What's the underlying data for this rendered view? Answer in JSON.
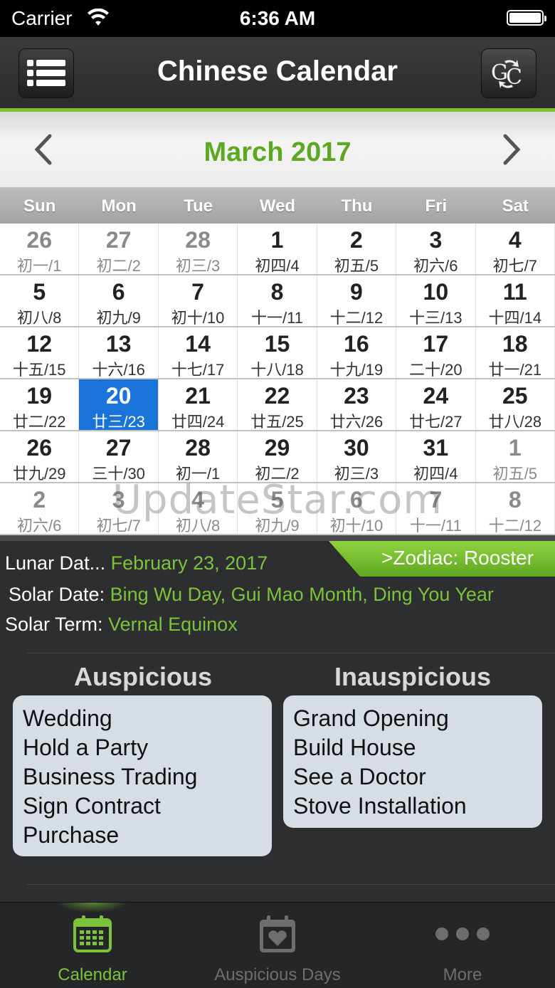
{
  "status": {
    "carrier": "Carrier",
    "time": "6:36 AM"
  },
  "nav": {
    "title": "Chinese Calendar"
  },
  "month": {
    "title": "March 2017"
  },
  "weekdays": [
    "Sun",
    "Mon",
    "Tue",
    "Wed",
    "Thu",
    "Fri",
    "Sat"
  ],
  "weeks": [
    [
      {
        "d": "26",
        "l": "初一/1",
        "o": true
      },
      {
        "d": "27",
        "l": "初二/2",
        "o": true
      },
      {
        "d": "28",
        "l": "初三/3",
        "o": true
      },
      {
        "d": "1",
        "l": "初四/4"
      },
      {
        "d": "2",
        "l": "初五/5"
      },
      {
        "d": "3",
        "l": "初六/6"
      },
      {
        "d": "4",
        "l": "初七/7"
      }
    ],
    [
      {
        "d": "5",
        "l": "初八/8"
      },
      {
        "d": "6",
        "l": "初九/9"
      },
      {
        "d": "7",
        "l": "初十/10"
      },
      {
        "d": "8",
        "l": "十一/11"
      },
      {
        "d": "9",
        "l": "十二/12"
      },
      {
        "d": "10",
        "l": "十三/13"
      },
      {
        "d": "11",
        "l": "十四/14"
      }
    ],
    [
      {
        "d": "12",
        "l": "十五/15"
      },
      {
        "d": "13",
        "l": "十六/16"
      },
      {
        "d": "14",
        "l": "十七/17"
      },
      {
        "d": "15",
        "l": "十八/18"
      },
      {
        "d": "16",
        "l": "十九/19"
      },
      {
        "d": "17",
        "l": "二十/20"
      },
      {
        "d": "18",
        "l": "廿一/21"
      }
    ],
    [
      {
        "d": "19",
        "l": "廿二/22"
      },
      {
        "d": "20",
        "l": "廿三/23",
        "t": true
      },
      {
        "d": "21",
        "l": "廿四/24"
      },
      {
        "d": "22",
        "l": "廿五/25"
      },
      {
        "d": "23",
        "l": "廿六/26"
      },
      {
        "d": "24",
        "l": "廿七/27"
      },
      {
        "d": "25",
        "l": "廿八/28"
      }
    ],
    [
      {
        "d": "26",
        "l": "廿九/29"
      },
      {
        "d": "27",
        "l": "三十/30"
      },
      {
        "d": "28",
        "l": "初一/1"
      },
      {
        "d": "29",
        "l": "初二/2"
      },
      {
        "d": "30",
        "l": "初三/3"
      },
      {
        "d": "31",
        "l": "初四/4"
      },
      {
        "d": "1",
        "l": "初五/5",
        "o": true
      }
    ],
    [
      {
        "d": "2",
        "l": "初六/6",
        "o": true
      },
      {
        "d": "3",
        "l": "初七/7",
        "o": true
      },
      {
        "d": "4",
        "l": "初八/8",
        "o": true
      },
      {
        "d": "5",
        "l": "初九/9",
        "o": true
      },
      {
        "d": "6",
        "l": "初十/10",
        "o": true
      },
      {
        "d": "7",
        "l": "十一/11",
        "o": true
      },
      {
        "d": "8",
        "l": "十二/12",
        "o": true
      }
    ]
  ],
  "watermark": "UpdateStar.com",
  "info": {
    "zodiac": ">Zodiac: Rooster",
    "lunar_label": "Lunar Dat...",
    "lunar_value": "February 23, 2017",
    "solar_label": "Solar Date:",
    "solar_value": "Bing Wu Day, Gui Mao Month, Ding You Year",
    "term_label": "Solar Term:",
    "term_value": "Vernal Equinox"
  },
  "auspicious": {
    "title": "Auspicious",
    "items": [
      "Wedding",
      "Hold a Party",
      "Business Trading",
      "Sign Contract",
      "Purchase"
    ]
  },
  "inauspicious": {
    "title": "Inauspicious",
    "items": [
      "Grand Opening",
      "Build House",
      "See a Doctor",
      "Stove Installation"
    ]
  },
  "tabs": [
    {
      "label": "Calendar",
      "icon": "calendar-icon",
      "active": true
    },
    {
      "label": "Auspicious Days",
      "icon": "heart-calendar-icon"
    },
    {
      "label": "More",
      "icon": "more-dots-icon"
    }
  ],
  "colors": {
    "accent": "#7cc23a",
    "today": "#1a73d9"
  }
}
